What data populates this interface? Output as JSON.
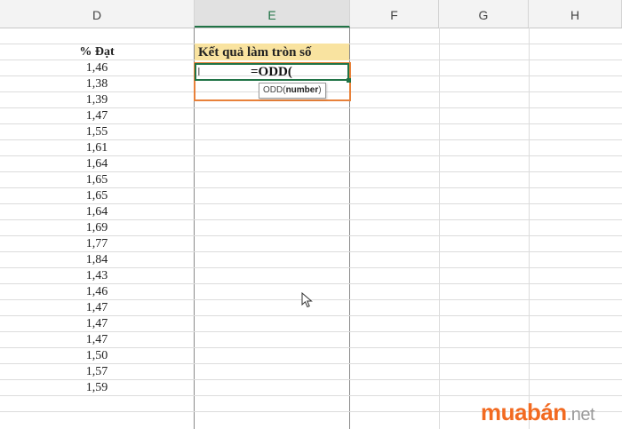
{
  "columns": [
    "D",
    "E",
    "F",
    "G",
    "H"
  ],
  "selected_column": "E",
  "column_d": {
    "header": "% Đạt",
    "values": [
      "1,46",
      "1,38",
      "1,39",
      "1,47",
      "1,55",
      "1,61",
      "1,64",
      "1,65",
      "1,65",
      "1,64",
      "1,69",
      "1,77",
      "1,84",
      "1,43",
      "1,46",
      "1,47",
      "1,47",
      "1,47",
      "1,50",
      "1,57",
      "1,59"
    ]
  },
  "column_e": {
    "header": "Kết quả làm tròn số",
    "active_formula": "=ODD(",
    "tooltip_func": "ODD(",
    "tooltip_arg": "number",
    "tooltip_close": ")"
  },
  "watermark": {
    "brand": "muabán",
    "suffix": ".net",
    "color": "#f26a21"
  },
  "colors": {
    "header_fill": "#f9e3a0",
    "highlight_frame": "#e8813a",
    "excel_green": "#217346"
  }
}
